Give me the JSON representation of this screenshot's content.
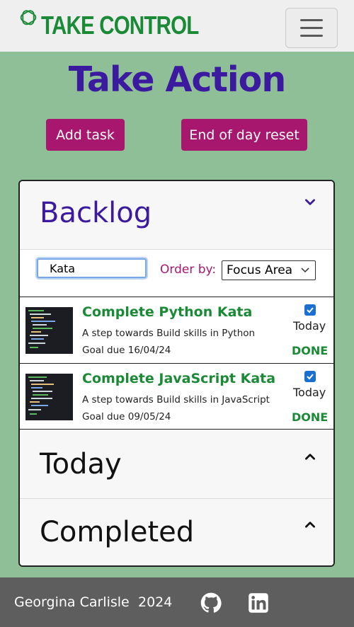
{
  "navbar": {
    "brand": "TAKE CONTROL",
    "brand_color": "#1a8a36",
    "icon": "openai-logo-icon",
    "toggle_icon": "hamburger-menu-icon"
  },
  "header": {
    "title": "Take Action",
    "buttons": {
      "add_task": "Add task",
      "reset": "End of day reset"
    }
  },
  "accordion": {
    "backlog": {
      "title": "Backlog",
      "search_value": "Kata",
      "order_label": "Order by:",
      "order_selected": "Focus Area",
      "tasks": [
        {
          "title": "Complete Python Kata",
          "description": "A step towards Build skills in Python",
          "goal": "Goal due 16/04/24",
          "checked": true,
          "today_label": "Today",
          "status": "DONE"
        },
        {
          "title": "Complete JavaScript Kata",
          "description": "A step towards Build skills in JavaScript",
          "goal": "Goal due 09/05/24",
          "checked": true,
          "today_label": "Today",
          "status": "DONE"
        }
      ]
    },
    "today": {
      "title": "Today"
    },
    "completed": {
      "title": "Completed"
    }
  },
  "footer": {
    "author": "Georgina Carlisle",
    "year": "2024",
    "icons": [
      "github-icon",
      "linkedin-icon"
    ]
  },
  "colors": {
    "background": "#8fbf96",
    "title": "#3b1a9f",
    "button": "#a8176e",
    "accent_green": "#1a8a36",
    "footer": "#5e5e5e"
  }
}
